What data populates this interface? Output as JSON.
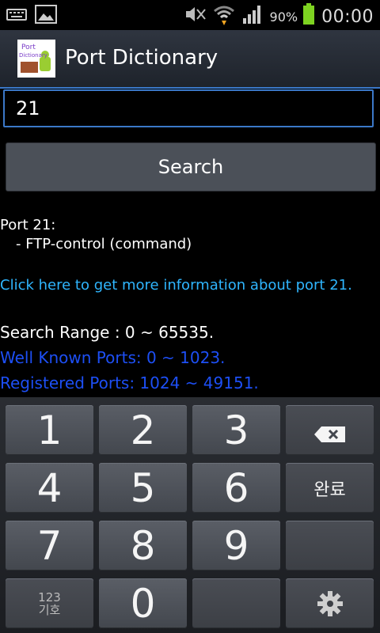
{
  "status_bar": {
    "battery_percent": "90%",
    "time": "00:00"
  },
  "app": {
    "title": "Port Dictionary",
    "logo_text": "Port Dictionary"
  },
  "search": {
    "value": "21",
    "button_label": "Search"
  },
  "results": {
    "port_heading": "Port 21:",
    "port_description": "- FTP-control (command)",
    "more_info_link": "Click here to get more information about port 21.",
    "search_range": "Search Range : 0 ~ 65535.",
    "well_known": "Well Known Ports: 0 ~ 1023.",
    "registered": "Registered Ports: 1024 ~ 49151."
  },
  "keypad": {
    "k1": "1",
    "k2": "2",
    "k3": "3",
    "k4": "4",
    "k5": "5",
    "k6": "6",
    "k7": "7",
    "k8": "8",
    "k9": "9",
    "k0": "0",
    "done": "완료",
    "sym_top": "123",
    "sym_bottom": "기호"
  },
  "colors": {
    "accent": "#3b78c8",
    "link": "#2fb6ff",
    "range_link": "#1d4ff5",
    "battery": "#7ed321"
  }
}
